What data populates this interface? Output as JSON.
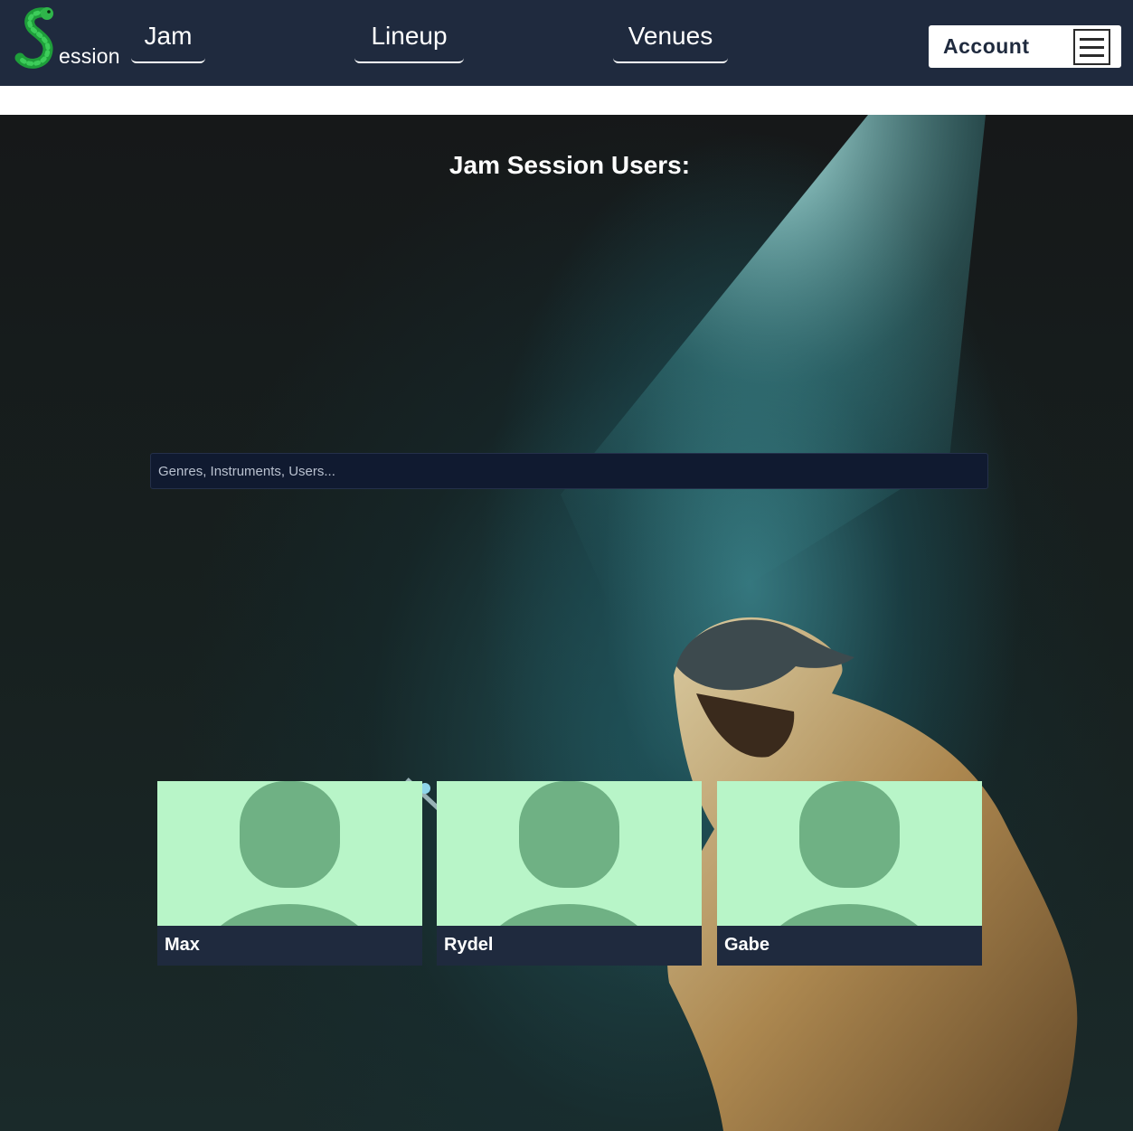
{
  "brand": {
    "wordmark": "ession",
    "logo_icon": "green-worm-s-icon",
    "logo_color": "#1e9e3a"
  },
  "nav": {
    "links": [
      {
        "label": "Jam"
      },
      {
        "label": "Lineup"
      },
      {
        "label": "Venues"
      }
    ],
    "account_label": "Account",
    "menu_icon": "hamburger-menu-icon"
  },
  "hero": {
    "title": "Jam Session Users:",
    "search_placeholder": "Genres, Instruments, Users..."
  },
  "users": [
    {
      "name": "Max",
      "avatar_icon": "default-avatar-icon"
    },
    {
      "name": "Rydel",
      "avatar_icon": "default-avatar-icon"
    },
    {
      "name": "Gabe",
      "avatar_icon": "default-avatar-icon"
    }
  ],
  "colors": {
    "navbar_bg": "#1f2a3e",
    "avatar_bg": "#b8f5c8",
    "avatar_figure": "#6fb184",
    "search_bg": "#101a30"
  }
}
